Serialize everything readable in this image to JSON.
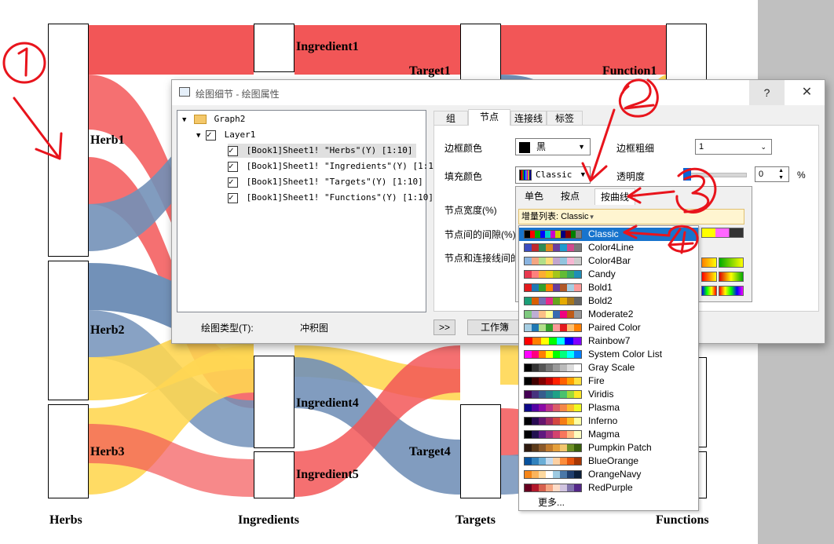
{
  "sankey": {
    "node_labels": {
      "herb1": "Herb1",
      "herb2": "Herb2",
      "herb3": "Herb3",
      "ing1": "Ingredient1",
      "ing4": "Ingredient4",
      "ing5": "Ingredient5",
      "t1": "Target1",
      "t4": "Target4",
      "f1": "Function1"
    },
    "axis_labels": [
      "Herbs",
      "Ingredients",
      "Targets",
      "Functions"
    ],
    "colors": {
      "red": "#f24d4f",
      "blue": "#6b8cb5",
      "yellow": "#ffd54a"
    }
  },
  "dialog": {
    "title": "绘图细节 - 绘图属性",
    "help": "?",
    "close": "✕",
    "tree": {
      "graph": "Graph2",
      "layer": "Layer1",
      "items": [
        "[Book1]Sheet1! \"Herbs\"(Y) [1:10]",
        "[Book1]Sheet1! \"Ingredients\"(Y) [1:10]",
        "[Book1]Sheet1! \"Targets\"(Y) [1:10]",
        "[Book1]Sheet1! \"Functions\"(Y) [1:10]"
      ]
    },
    "plot_type_label": "绘图类型(T):",
    "plot_type_value": "冲积图",
    "expand_btn": ">>",
    "workbook_btn": "工作簿",
    "tabs": [
      "组",
      "节点",
      "连接线",
      "标签"
    ],
    "fields": {
      "border_color_label": "边框颜色",
      "border_color_value": "黑",
      "border_width_label": "边框粗细",
      "border_width_value": "1",
      "fill_color_label": "填充颜色",
      "fill_color_value": "Classic",
      "transparency_label": "透明度",
      "transparency_value": "0",
      "percent": "%",
      "node_width_label": "节点宽度(%)",
      "node_gap_label": "节点间的间隙(%)",
      "node_link_label": "节点和连接线间的"
    }
  },
  "popup": {
    "tabs": [
      "单色",
      "按点",
      "按曲线"
    ],
    "incremental_label": "增量列表: Classic"
  },
  "colorlist": {
    "selected": "Classic",
    "items": [
      {
        "name": "Classic",
        "colors": [
          "#000000",
          "#ff0000",
          "#00aa00",
          "#0000ff",
          "#00cccc",
          "#cc00cc",
          "#cccc00",
          "#000080",
          "#800000",
          "#008000",
          "#808080"
        ]
      },
      {
        "name": "Color4Line",
        "colors": [
          "#3b4cc0",
          "#c0282d",
          "#2e8b57",
          "#e08a1e",
          "#6b3fa0",
          "#1f9bcf",
          "#d04a8f",
          "#7a7a7a"
        ]
      },
      {
        "name": "Color4Bar",
        "colors": [
          "#8ab4e0",
          "#f4a582",
          "#b2df8a",
          "#fddc7a",
          "#c2a5cf",
          "#92c5de",
          "#f7b6d2",
          "#cccccc"
        ]
      },
      {
        "name": "Candy",
        "colors": [
          "#e8384f",
          "#fd817d",
          "#fdae33",
          "#eecc16",
          "#a4c61a",
          "#62bb35",
          "#37a862",
          "#208eb7"
        ]
      },
      {
        "name": "Bold1",
        "colors": [
          "#e31a1c",
          "#1f78b4",
          "#33a02c",
          "#ff7f00",
          "#6a3d9a",
          "#b15928",
          "#a6cee3",
          "#fb9a99"
        ]
      },
      {
        "name": "Bold2",
        "colors": [
          "#1b9e77",
          "#d95f02",
          "#7570b3",
          "#e7298a",
          "#66a61e",
          "#e6ab02",
          "#a6761d",
          "#666666"
        ]
      },
      {
        "name": "Moderate2",
        "colors": [
          "#7fc97f",
          "#beaed4",
          "#fdc086",
          "#ffff99",
          "#386cb0",
          "#f0027f",
          "#bf5b17",
          "#999999"
        ]
      },
      {
        "name": "Paired Color",
        "colors": [
          "#a6cee3",
          "#1f78b4",
          "#b2df8a",
          "#33a02c",
          "#fb9a99",
          "#e31a1c",
          "#fdbf6f",
          "#ff7f00"
        ]
      },
      {
        "name": "Rainbow7",
        "colors": [
          "#ff0000",
          "#ff8000",
          "#ffff00",
          "#00ff00",
          "#00ffff",
          "#0000ff",
          "#8000ff"
        ]
      },
      {
        "name": "System Color List",
        "colors": [
          "#ff00ff",
          "#ff0080",
          "#ff8000",
          "#ffff00",
          "#00ff00",
          "#00ff80",
          "#00ffff",
          "#0080ff"
        ]
      },
      {
        "name": "Gray Scale",
        "colors": [
          "#000000",
          "#333333",
          "#555555",
          "#777777",
          "#999999",
          "#bbbbbb",
          "#dddddd",
          "#ffffff"
        ]
      },
      {
        "name": "Fire",
        "colors": [
          "#000000",
          "#400000",
          "#800000",
          "#c00000",
          "#ff2000",
          "#ff6000",
          "#ffa000",
          "#ffe040"
        ]
      },
      {
        "name": "Viridis",
        "colors": [
          "#440154",
          "#46337e",
          "#365c8d",
          "#277f8e",
          "#1fa187",
          "#4ac16d",
          "#a0da39",
          "#fde725"
        ]
      },
      {
        "name": "Plasma",
        "colors": [
          "#0d0887",
          "#5302a3",
          "#8b0aa5",
          "#b83289",
          "#db5c68",
          "#f48849",
          "#febd2a",
          "#f0f921"
        ]
      },
      {
        "name": "Inferno",
        "colors": [
          "#000004",
          "#280b53",
          "#65156e",
          "#9f2a63",
          "#d44842",
          "#f57d15",
          "#fac127",
          "#fcffa4"
        ]
      },
      {
        "name": "Magma",
        "colors": [
          "#000004",
          "#221150",
          "#5f187f",
          "#982d80",
          "#d3436e",
          "#f8765c",
          "#febb81",
          "#fcfdbf"
        ]
      },
      {
        "name": "Pumpkin Patch",
        "colors": [
          "#2e1a0f",
          "#5b3a1a",
          "#8b5a2b",
          "#c27c2e",
          "#e5a03c",
          "#f2c66d",
          "#6b8e23",
          "#3a5f0b"
        ]
      },
      {
        "name": "BlueOrange",
        "colors": [
          "#08519c",
          "#3182bd",
          "#6baed6",
          "#c6dbef",
          "#fdd0a2",
          "#fd8d3c",
          "#e6550d",
          "#a63603"
        ]
      },
      {
        "name": "OrangeNavy",
        "colors": [
          "#f58518",
          "#fbb45c",
          "#fdd9a0",
          "#ffffff",
          "#9ecae1",
          "#4a78a8",
          "#1f3f6e",
          "#0b1f3a"
        ]
      },
      {
        "name": "RedPurple",
        "colors": [
          "#67001f",
          "#b2182b",
          "#d6604d",
          "#f4a582",
          "#fddbc7",
          "#d1c4e0",
          "#8073ac",
          "#542788"
        ]
      }
    ],
    "more": "更多..."
  },
  "annotations": [
    "1",
    "2",
    "3",
    "4"
  ]
}
